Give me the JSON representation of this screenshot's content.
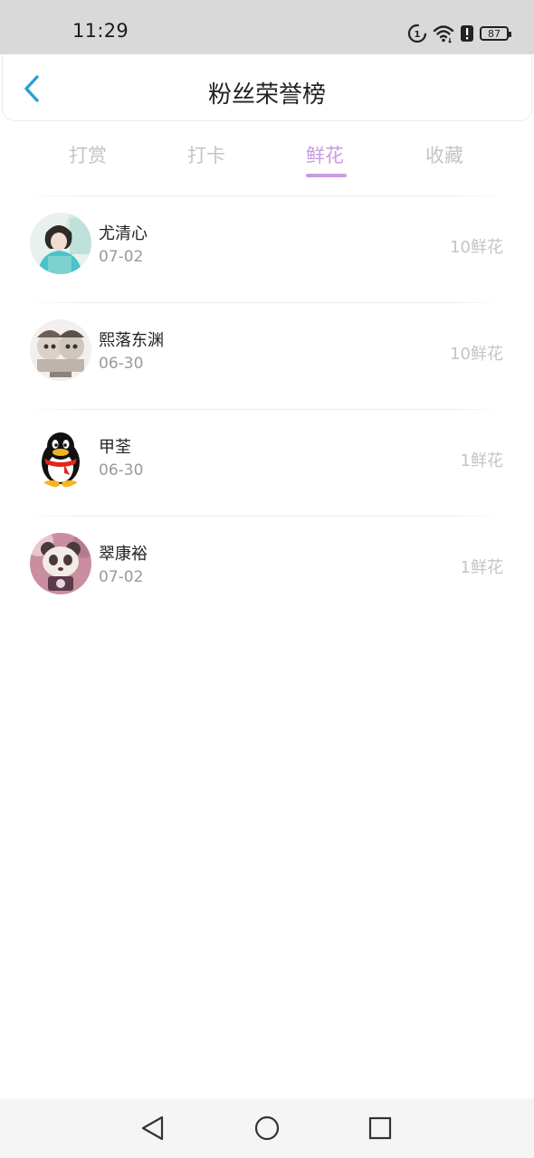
{
  "status_bar": {
    "time": "11:29",
    "battery": "87"
  },
  "header": {
    "back_icon": "chevron-left-icon",
    "title": "粉丝荣誉榜"
  },
  "tabs": [
    {
      "label": "打赏",
      "active": false
    },
    {
      "label": "打卡",
      "active": false
    },
    {
      "label": "鲜花",
      "active": true
    },
    {
      "label": "收藏",
      "active": false
    }
  ],
  "fans": [
    {
      "name": "尤清心",
      "date": "07-02",
      "amount": "10鲜花"
    },
    {
      "name": "熙落东渊",
      "date": "06-30",
      "amount": "10鲜花"
    },
    {
      "name": "甲荃",
      "date": "06-30",
      "amount": "1鲜花"
    },
    {
      "name": "翠康裕",
      "date": "07-02",
      "amount": "1鲜花"
    }
  ],
  "colors": {
    "accent": "#c99be0",
    "back_arrow": "#2a9fd8",
    "muted_text": "#c4c4c4"
  },
  "nav_bar": {
    "icons": [
      "back-triangle-icon",
      "home-circle-icon",
      "recents-square-icon"
    ]
  }
}
